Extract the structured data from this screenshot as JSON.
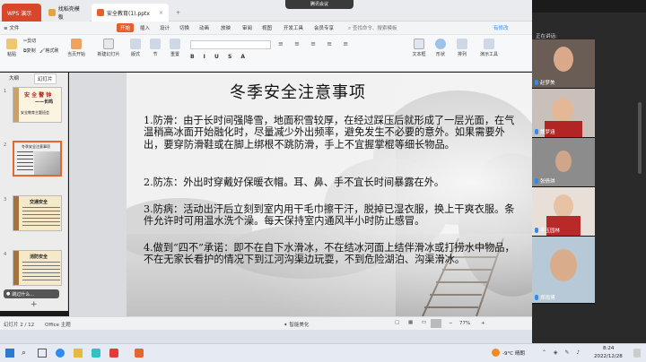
{
  "tabs": [
    {
      "label": "WPS 演示",
      "color": "#d8472b"
    },
    {
      "label": "找稻壳模板",
      "color": "#e6a23c"
    },
    {
      "label": "安全教育(1).pptx",
      "color": "#e85d2a"
    }
  ],
  "meeting_pill": "腾讯会议",
  "menu": {
    "file": "≡ 文件",
    "tabs": [
      "开始",
      "插入",
      "设计",
      "切换",
      "动画",
      "放映",
      "审阅",
      "视图",
      "开发工具",
      "会员专享"
    ],
    "active_tab": "开始",
    "search": "查找命令、搜索模板",
    "cloud": "有修改"
  },
  "toolbar": {
    "paste": "粘贴",
    "cut": "剪切",
    "copy": "复制",
    "format_painter": "格式刷",
    "from_current": "当页开始",
    "new_slide": "新建幻灯片",
    "layout": "版式",
    "section": "节",
    "reset": "重置",
    "textbox": "文本框",
    "shape": "形状",
    "arrange": "排列",
    "outline": "演示工具"
  },
  "left_panel": {
    "tab_outline": "大纲",
    "tab_slides": "幻灯片",
    "thumbs": [
      {
        "num": "1",
        "title": "安 全 警 钟",
        "subtitle": "——长鸣",
        "foot": "安全教育主题班会"
      },
      {
        "num": "2",
        "title": "冬季安全注意事项",
        "subtitle": "",
        "foot": ""
      },
      {
        "num": "3",
        "title": "交通安全",
        "subtitle": "",
        "foot": ""
      },
      {
        "num": "4",
        "title": "消防安全",
        "subtitle": "",
        "foot": ""
      }
    ],
    "notes_hint": "跳过什么...",
    "add": "+"
  },
  "slide": {
    "title": "冬季安全注意事项",
    "paragraphs": [
      "1.防滑：由于长时间强降雪，地面积雪较厚，在经过踩压后就形成了一层光面，在气温稍高冰面开始融化时，尽量减少外出频率，避免发生不必要的意外。如果需要外出，要穿防滑鞋或在脚上绑根不跳防滑，手上不宜握掌棍等细长物品。",
      "2.防冻：外出时穿戴好保暖衣帽。耳、鼻、手不宜长时间暴露在外。",
      "3.防病：活动出汗后立刻到室内用干毛巾擦干汗，脱掉已湿衣服，换上干爽衣服。条件允许时可用温水洗个澡。每天保持室内通风半小时防止感冒。",
      "4.做到“四不”承诺：即不在自下水滑冰，不在结冰河面上结伴滑冰或打捞水中物品，不在无家长看护的情况下到江河沟渠边玩耍，不到危险湖泊、沟渠滑冰。"
    ]
  },
  "status": {
    "slide_counter": "幻灯片 2 / 12",
    "theme": "Office 主题",
    "notes": "智能美化",
    "zoom": "77%"
  },
  "video": {
    "header": "正在讲话:",
    "participants": [
      "赵梦美",
      "魏梦涵",
      "张倩琪",
      "辛玉园林",
      "郑雨博"
    ]
  },
  "taskbar": {
    "weather": "-9°C 晴朗",
    "time": "8:24",
    "date": "2022/12/28"
  }
}
